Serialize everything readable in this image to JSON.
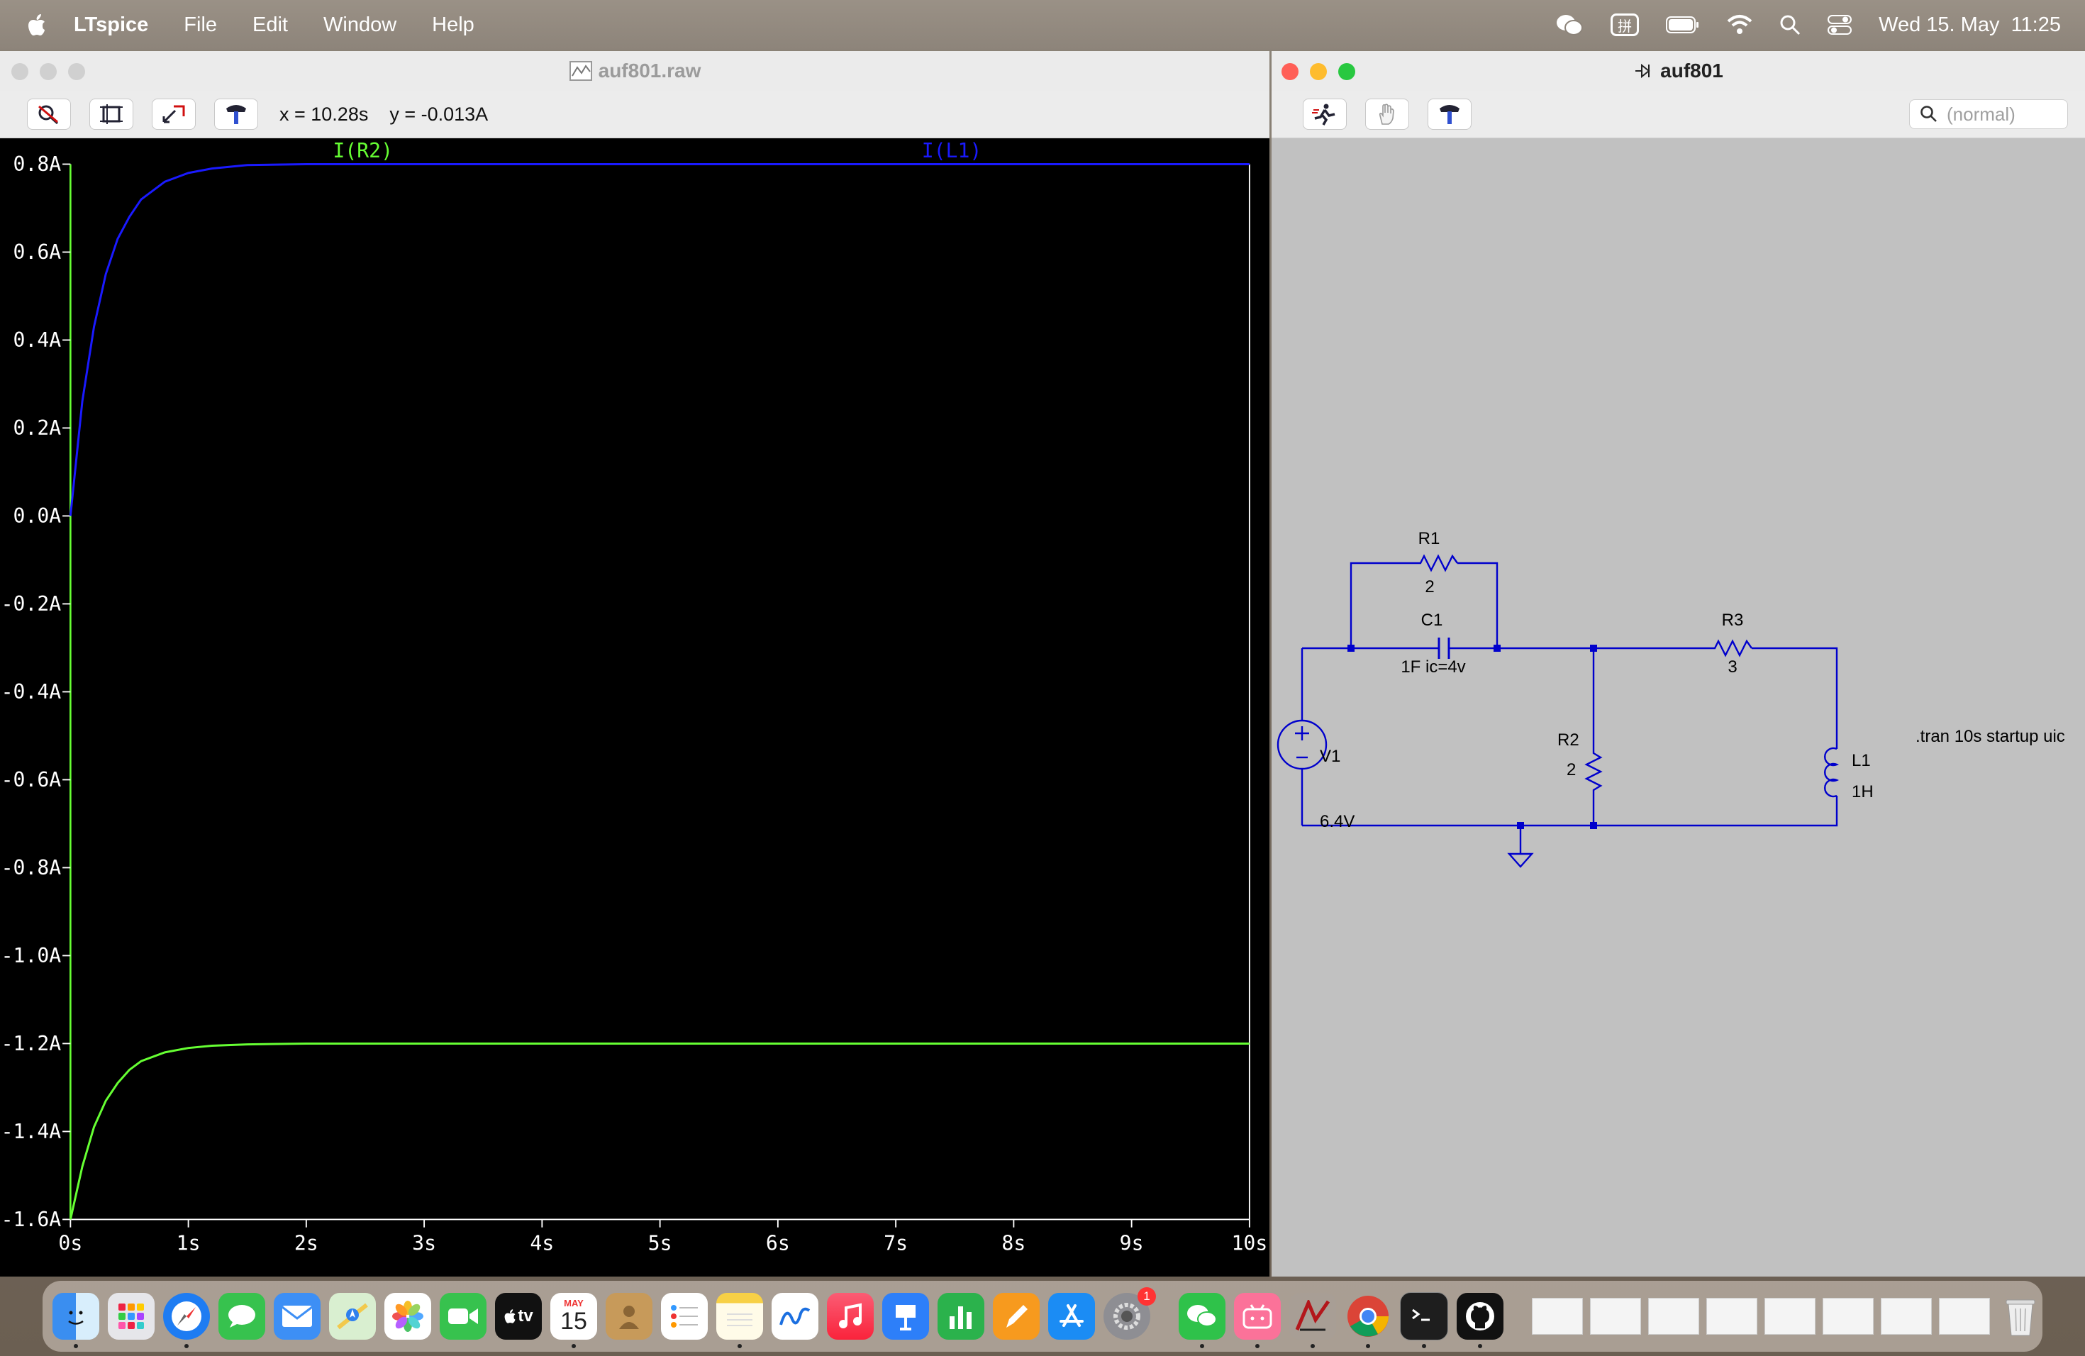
{
  "menubar": {
    "app_name": "LTspice",
    "items": [
      "File",
      "Edit",
      "Window",
      "Help"
    ],
    "status_icons": [
      "wechat-icon",
      "input-method-icon",
      "battery-icon",
      "wifi-icon",
      "spotlight-icon",
      "control-center-icon"
    ],
    "input_method_label": "拼",
    "clock": "Wed 15. May  11:25"
  },
  "plot_window": {
    "title": "auf801.raw",
    "cursor_x": "x = 10.28s",
    "cursor_y": "y = -0.013A",
    "toolbar_icons": [
      "autorange-icon",
      "zoom-extents-icon",
      "zoom-back-icon",
      "probe-hammer-icon"
    ]
  },
  "chart_data": {
    "type": "line",
    "xlabel": "",
    "ylabel": "",
    "xlim": [
      0,
      10
    ],
    "ylim": [
      -1.6,
      0.8
    ],
    "x_ticks": [
      "0s",
      "1s",
      "2s",
      "3s",
      "4s",
      "5s",
      "6s",
      "7s",
      "8s",
      "9s",
      "10s"
    ],
    "y_ticks": [
      "0.8A",
      "0.6A",
      "0.4A",
      "0.2A",
      "0.0A",
      "-0.2A",
      "-0.4A",
      "-0.6A",
      "-0.8A",
      "-1.0A",
      "-1.2A",
      "-1.4A",
      "-1.6A"
    ],
    "background": "#000000",
    "series": [
      {
        "name": "I(R2)",
        "color": "#66ff33",
        "x": [
          0,
          0.1,
          0.2,
          0.3,
          0.4,
          0.5,
          0.6,
          0.8,
          1.0,
          1.2,
          1.5,
          2.0,
          3.0,
          10.0
        ],
        "values": [
          -1.6,
          -1.48,
          -1.39,
          -1.33,
          -1.29,
          -1.26,
          -1.24,
          -1.22,
          -1.21,
          -1.205,
          -1.202,
          -1.2,
          -1.2,
          -1.2
        ]
      },
      {
        "name": "I(L1)",
        "color": "#1a1aff",
        "x": [
          0,
          0.1,
          0.2,
          0.3,
          0.4,
          0.5,
          0.6,
          0.8,
          1.0,
          1.2,
          1.5,
          2.0,
          3.0,
          10.0
        ],
        "values": [
          0.0,
          0.26,
          0.43,
          0.55,
          0.63,
          0.68,
          0.72,
          0.76,
          0.78,
          0.79,
          0.798,
          0.8,
          0.8,
          0.8
        ]
      }
    ]
  },
  "schematic_window": {
    "title": "auf801",
    "search_placeholder": "(normal)",
    "toolbar_icons": [
      "run-icon",
      "hand-pan-icon",
      "probe-hammer-icon"
    ],
    "components": {
      "R1": {
        "name": "R1",
        "value": "2"
      },
      "C1": {
        "name": "C1",
        "value": "1F ic=4v"
      },
      "R3": {
        "name": "R3",
        "value": "3"
      },
      "R2": {
        "name": "R2",
        "value": "2"
      },
      "L1": {
        "name": "L1",
        "value": "1H"
      },
      "V1": {
        "name": "V1",
        "value": "6.4V"
      }
    },
    "directive": ".tran 10s startup uic",
    "wire_color": "#0000cc"
  },
  "dock": {
    "calendar_month": "MAY",
    "calendar_day": "15",
    "settings_badge": "1",
    "apps": [
      "finder",
      "launchpad",
      "safari",
      "messages",
      "mail",
      "maps",
      "photos",
      "facetime",
      "apple-tv",
      "calendar",
      "contacts",
      "reminders",
      "notes",
      "freeform",
      "music",
      "keynote",
      "numbers",
      "pages",
      "app-store",
      "system-settings",
      "wechat",
      "bilibili",
      "ltspice",
      "chrome",
      "terminal",
      "github-desktop",
      "trash"
    ],
    "tv_label": "tv"
  }
}
